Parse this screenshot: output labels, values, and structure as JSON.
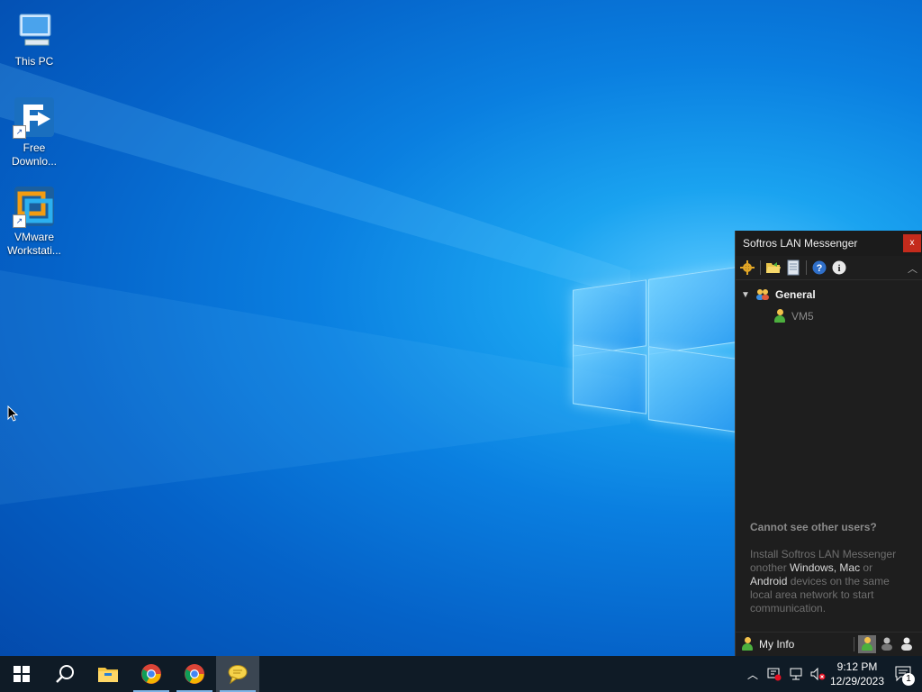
{
  "desktop": {
    "icons": [
      {
        "label": "This PC",
        "icon": "computer-icon"
      },
      {
        "label": "Free Downlo...",
        "icon": "free-download-manager-icon"
      },
      {
        "label": "VMware Workstati...",
        "icon": "vmware-workstation-icon"
      }
    ]
  },
  "messenger": {
    "title": "Softros LAN Messenger",
    "close_label": "x",
    "toolbar": [
      "settings-icon",
      "open-folder-icon",
      "message-history-icon",
      "help-icon",
      "info-icon"
    ],
    "group": {
      "name": "General",
      "users": [
        "VM5"
      ]
    },
    "help": {
      "title": "Cannot see other users?",
      "text_1": "Install Softros LAN Messenger onother ",
      "link_windows": "Windows,",
      "link_mac": "Mac",
      "text_or": " or ",
      "link_android": "Android",
      "text_2": " devices on the same local area network to start communication."
    },
    "status": {
      "my_info_label": "My Info",
      "current_status": "online"
    }
  },
  "taskbar": {
    "items": [
      "start-icon",
      "search-icon",
      "file-explorer-icon",
      "chrome-icon",
      "chrome-icon",
      "softros-messenger-icon"
    ],
    "clock": {
      "time": "9:12 PM",
      "date": "12/29/2023"
    },
    "notification_count": "1"
  },
  "colors": {
    "accent": "#0a7fe0",
    "messenger_bg": "#1e1e1e",
    "close_red": "#c42b1c",
    "taskbar": "#0f1b26"
  }
}
